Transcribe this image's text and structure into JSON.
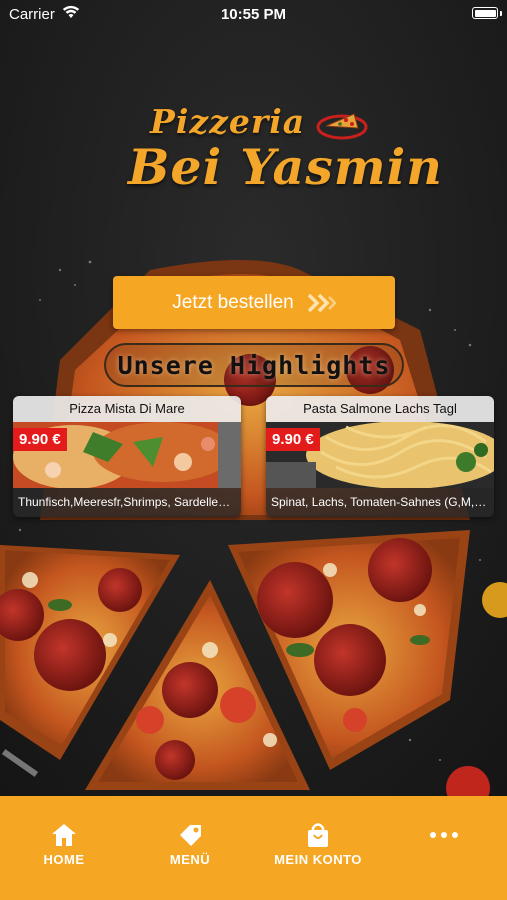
{
  "status_bar": {
    "carrier": "Carrier",
    "time": "10:55 PM"
  },
  "logo": {
    "line1": "Pizzeria",
    "line2": "Bei Yasmin",
    "color": "#f4a62a"
  },
  "order_button": {
    "label": "Jetzt bestellen",
    "icon": "double-chevron-right-icon",
    "color": "#f5a623"
  },
  "highlights": {
    "title": "Unsere Highlights"
  },
  "products": [
    {
      "title": "Pizza Mista Di Mare",
      "price": "9.90 €",
      "description": "Thunfisch,Meeresfr,Shrimps, Sardellen (...",
      "image": "seafood-pizza-image"
    },
    {
      "title": "Pasta Salmone Lachs Tagl",
      "price": "9.90 €",
      "description": "Spinat, Lachs, Tomaten-Sahnes (G,M,E,F)",
      "image": "salmon-pasta-image"
    }
  ],
  "tabbar": {
    "color": "#f5a623",
    "items": [
      {
        "label": "HOME",
        "icon": "home-icon"
      },
      {
        "label": "MENÜ",
        "icon": "tag-icon"
      },
      {
        "label": "MEIN KONTO",
        "icon": "shopping-bag-icon"
      },
      {
        "label": "",
        "icon": "more-dots-icon"
      }
    ]
  },
  "colors": {
    "accent": "#f5a623",
    "price_badge": "#e31b1b"
  }
}
